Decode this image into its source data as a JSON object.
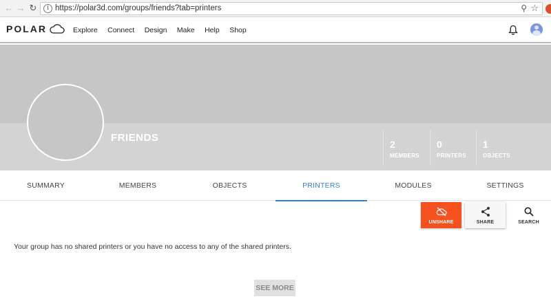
{
  "browser": {
    "back_icon": "arrow-left-icon",
    "forward_icon": "arrow-right-icon",
    "reload_icon": "reload-icon",
    "url": "https://polar3d.com/groups/friends?tab=printers"
  },
  "header": {
    "logo_text": "POLAR",
    "nav": [
      "Explore",
      "Connect",
      "Design",
      "Make",
      "Help",
      "Shop"
    ]
  },
  "group": {
    "name": "FRIENDS",
    "stats": [
      {
        "value": "2",
        "label": "MEMBERS"
      },
      {
        "value": "0",
        "label": "PRINTERS"
      },
      {
        "value": "1",
        "label": "OBJECTS"
      }
    ]
  },
  "tabs": [
    "SUMMARY",
    "MEMBERS",
    "OBJECTS",
    "PRINTERS",
    "MODULES",
    "SETTINGS"
  ],
  "active_tab": "PRINTERS",
  "actions": {
    "unshare": "UNSHARE",
    "share": "SHARE",
    "search": "SEARCH"
  },
  "empty_message": "Your group has no shared printers or you have no access to any of the shared printers.",
  "see_more": "SEE MORE",
  "colors": {
    "accent": "#2f7fd8",
    "unshare": "#f4511e",
    "banner": "#c6c6c6"
  }
}
